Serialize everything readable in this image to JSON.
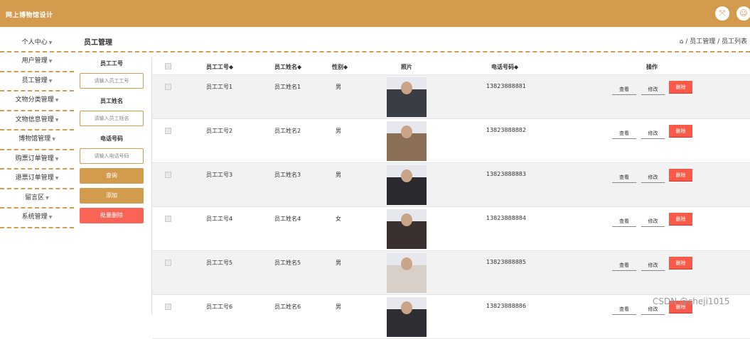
{
  "header": {
    "title": "网上博物馆设计",
    "icons": [
      "fullscreen-icon",
      "user-icon"
    ]
  },
  "topbar": {
    "page_title": "员工管理",
    "breadcrumb": "⌂ / 员工管理 / 员工列表"
  },
  "sidebar": {
    "top": "个人中心",
    "items": [
      "用户管理",
      "员工管理",
      "文物分类管理",
      "文物信息管理",
      "博物馆管理",
      "购票订单管理",
      "退票订单管理",
      "留言区",
      "系统管理"
    ]
  },
  "search": {
    "id_label": "员工工号",
    "id_placeholder": "请输入员工工号",
    "name_label": "员工姓名",
    "name_placeholder": "请输入员工姓名",
    "phone_label": "电话号码",
    "phone_placeholder": "请输入电话号码",
    "query": "查询",
    "add": "添加",
    "batch_delete": "批量删除"
  },
  "table": {
    "headers": {
      "id": "员工工号◆",
      "name": "员工姓名◆",
      "gender": "性别◆",
      "photo": "照片",
      "phone": "电话号码◆",
      "ops": "操作"
    },
    "rows": [
      {
        "id": "员工工号1",
        "name": "员工姓名1",
        "gender": "男",
        "phone": "13823888881"
      },
      {
        "id": "员工工号2",
        "name": "员工姓名2",
        "gender": "男",
        "phone": "13823888882"
      },
      {
        "id": "员工工号3",
        "name": "员工姓名3",
        "gender": "男",
        "phone": "13823888883"
      },
      {
        "id": "员工工号4",
        "name": "员工姓名4",
        "gender": "女",
        "phone": "13823888884"
      },
      {
        "id": "员工工号5",
        "name": "员工姓名5",
        "gender": "男",
        "phone": "13823888885"
      },
      {
        "id": "员工工号6",
        "name": "员工姓名6",
        "gender": "男",
        "phone": "13823888886"
      }
    ],
    "actions": {
      "view": "查看",
      "edit": "修改",
      "delete": "删除"
    }
  },
  "watermark": "CSDN @sheji1015",
  "colors": {
    "primary": "#d39b4e",
    "danger": "#fa6456"
  }
}
